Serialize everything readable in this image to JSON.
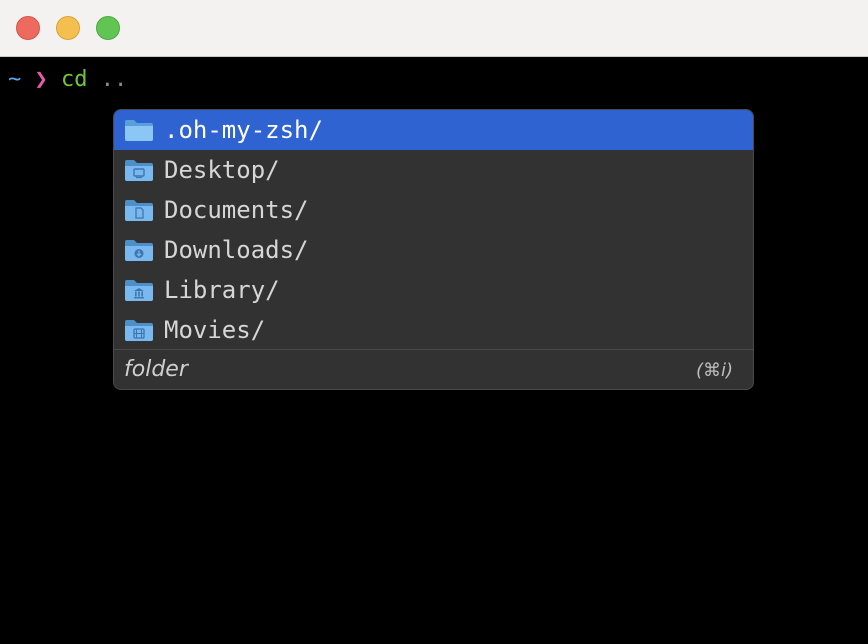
{
  "terminal": {
    "prompt_symbol": "~",
    "prompt_arrow": "❯",
    "command": "cd",
    "argument": ".."
  },
  "completion": {
    "items": [
      {
        "label": ".oh-my-zsh/",
        "icon": "folder-icon",
        "selected": true
      },
      {
        "label": "Desktop/",
        "icon": "desktop-folder-icon",
        "selected": false
      },
      {
        "label": "Documents/",
        "icon": "documents-folder-icon",
        "selected": false
      },
      {
        "label": "Downloads/",
        "icon": "downloads-folder-icon",
        "selected": false
      },
      {
        "label": "Library/",
        "icon": "library-folder-icon",
        "selected": false
      },
      {
        "label": "Movies/",
        "icon": "movies-folder-icon",
        "selected": false
      }
    ],
    "footer": {
      "type_label": "folder",
      "shortcut": "(⌘i)"
    }
  },
  "colors": {
    "selection": "#2f63d1",
    "popup_background": "#323232",
    "folder_icon": "#7ab8f0"
  }
}
